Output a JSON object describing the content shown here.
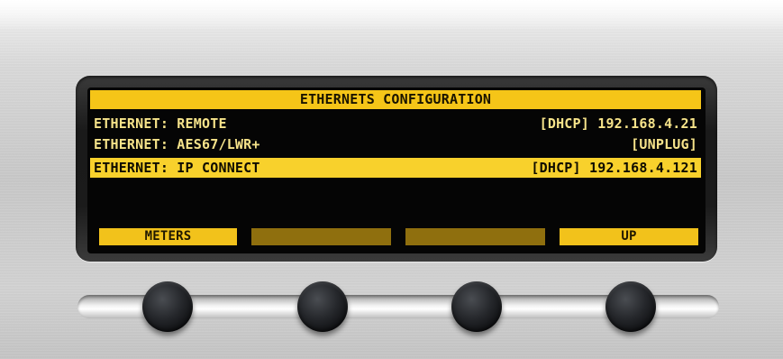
{
  "screen": {
    "title": "ETHERNETS CONFIGURATION",
    "rows": [
      {
        "label": "ETHERNET: REMOTE",
        "value": "[DHCP] 192.168.4.21",
        "selected": false
      },
      {
        "label": "ETHERNET: AES67/LWR+",
        "value": "[UNPLUG]",
        "selected": false
      },
      {
        "label": "ETHERNET: IP CONNECT",
        "value": "[DHCP] 192.168.4.121",
        "selected": true
      }
    ],
    "softkeys": [
      "METERS",
      "",
      "",
      "UP"
    ]
  },
  "colors": {
    "accent": "#f5c518",
    "inactive_softkey": "#8f6f0e",
    "screen_text": "#f6e38a",
    "screen_background": "#050505"
  },
  "knobs": [
    "knob-1",
    "knob-2",
    "knob-3",
    "knob-4"
  ]
}
